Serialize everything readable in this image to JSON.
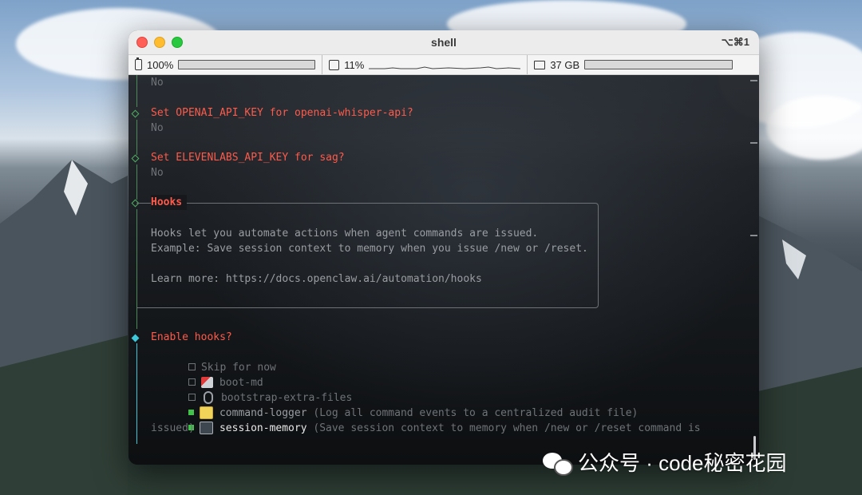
{
  "window": {
    "title": "shell",
    "shortcut": "⌥⌘1"
  },
  "status": {
    "battery": {
      "label": "100%",
      "level": 1.0
    },
    "cpu": {
      "label": "11%",
      "level": 0.11
    },
    "memory": {
      "label": "37 GB"
    }
  },
  "terminal": {
    "prev_answer": "No",
    "q1": {
      "text": "Set OPENAI_API_KEY for openai-whisper-api?",
      "answer": "No"
    },
    "q2": {
      "text": "Set ELEVENLABS_API_KEY for sag?",
      "answer": "No"
    },
    "hooks": {
      "title": "Hooks",
      "line1": "Hooks let you automate actions when agent commands are issued.",
      "line2": "Example: Save session context to memory when you issue /new or /reset.",
      "line3": "Learn more: https://docs.openclaw.ai/automation/hooks"
    },
    "prompt": "Enable hooks?",
    "options": [
      {
        "label": "Skip for now",
        "desc": "",
        "checked": false,
        "icon": ""
      },
      {
        "label": "boot-md",
        "desc": "",
        "checked": false,
        "icon": "rocket-icon"
      },
      {
        "label": "bootstrap-extra-files",
        "desc": "",
        "checked": false,
        "icon": "paperclip-icon"
      },
      {
        "label": "command-logger",
        "desc": "(Log all command events to a centralized audit file)",
        "checked": true,
        "icon": "memo-icon"
      },
      {
        "label": "session-memory",
        "desc": "(Save session context to memory when /new or /reset command is",
        "desc_cont": "issued)",
        "checked": true,
        "icon": "floppy-disk-icon"
      }
    ]
  },
  "watermark": {
    "text": "公众号 · code秘密花园"
  }
}
